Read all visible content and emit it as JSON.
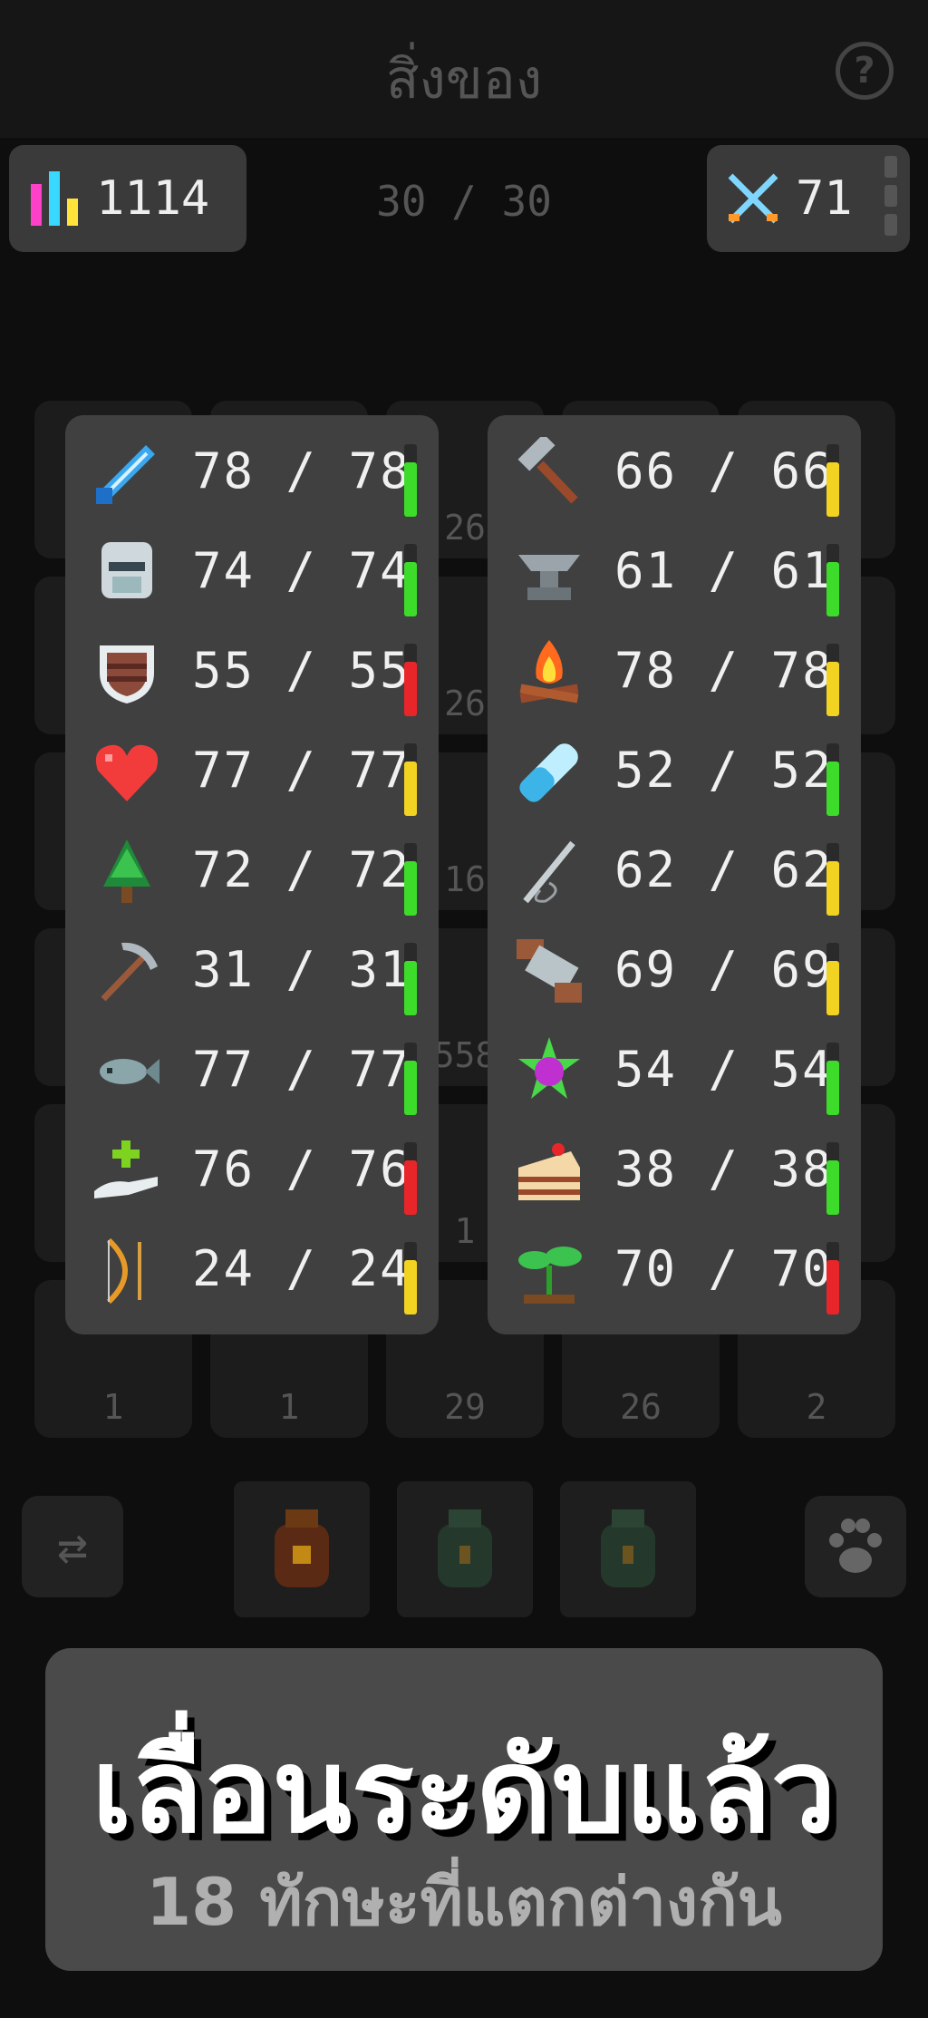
{
  "header": {
    "title": "สิ่งของ",
    "help_icon": "question-circle-icon"
  },
  "stats": {
    "total_level": "1114",
    "capacity": "30 / 30",
    "combat_level": "71"
  },
  "inventory_counts": [
    "26",
    "26",
    "16",
    "558",
    "1",
    "1",
    "1",
    "29",
    "26",
    "2"
  ],
  "skills_left": [
    {
      "icon": "sword-icon",
      "value": "78 / 78",
      "bar": "green"
    },
    {
      "icon": "helmet-icon",
      "value": "74 / 74",
      "bar": "green"
    },
    {
      "icon": "shield-icon",
      "value": "55 / 55",
      "bar": "red"
    },
    {
      "icon": "heart-icon",
      "value": "77 / 77",
      "bar": "yellow"
    },
    {
      "icon": "tree-icon",
      "value": "72 / 72",
      "bar": "green"
    },
    {
      "icon": "pickaxe-icon",
      "value": "31 / 31",
      "bar": "green"
    },
    {
      "icon": "fish-icon",
      "value": "77 / 77",
      "bar": "green"
    },
    {
      "icon": "healing-hand-icon",
      "value": "76 / 76",
      "bar": "red"
    },
    {
      "icon": "bow-icon",
      "value": "24 / 24",
      "bar": "yellow"
    }
  ],
  "skills_right": [
    {
      "icon": "hammer-icon",
      "value": "66 / 66",
      "bar": "yellow"
    },
    {
      "icon": "anvil-icon",
      "value": "61 / 61",
      "bar": "green"
    },
    {
      "icon": "campfire-icon",
      "value": "78 / 78",
      "bar": "yellow"
    },
    {
      "icon": "potion-vial-icon",
      "value": "52 / 52",
      "bar": "green"
    },
    {
      "icon": "needle-icon",
      "value": "62 / 62",
      "bar": "yellow"
    },
    {
      "icon": "saw-icon",
      "value": "69 / 69",
      "bar": "yellow"
    },
    {
      "icon": "magic-gem-icon",
      "value": "54 / 54",
      "bar": "green"
    },
    {
      "icon": "cake-icon",
      "value": "38 / 38",
      "bar": "green"
    },
    {
      "icon": "sprout-icon",
      "value": "70 / 70",
      "bar": "red"
    }
  ],
  "colors": {
    "green": "#3ddc2a",
    "yellow": "#f2d321",
    "red": "#e8262a",
    "bar_bg": "#2a2a2a"
  },
  "banner": {
    "title": "เลื่อนระดับแล้ว",
    "subtitle": "18 ทักษะที่แตกต่างกัน"
  }
}
